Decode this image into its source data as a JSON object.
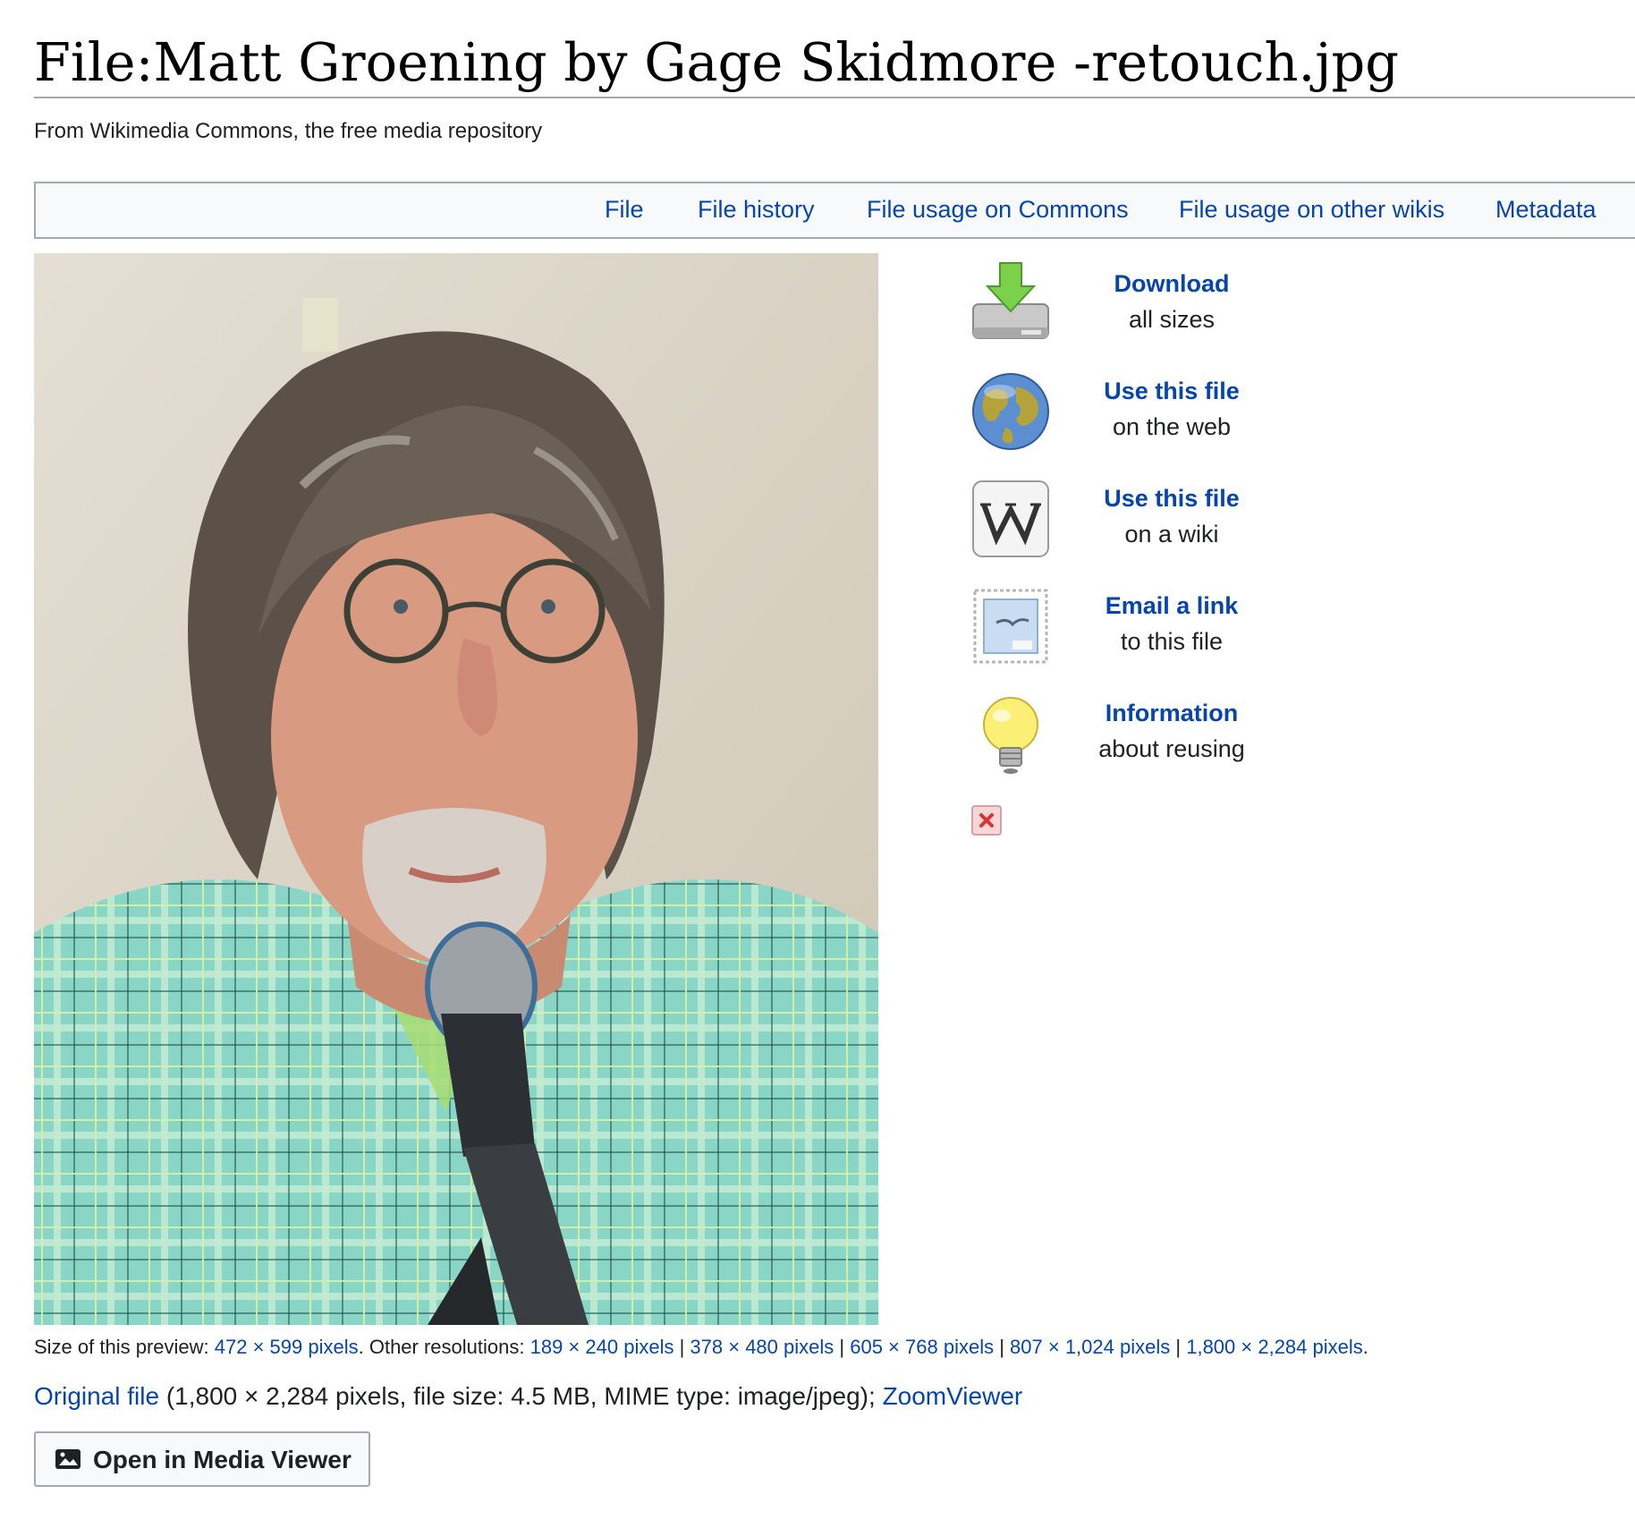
{
  "page": {
    "title": "File:Matt Groening by Gage Skidmore -retouch.jpg",
    "subtitle": "From Wikimedia Commons, the free media repository"
  },
  "tabs": [
    {
      "label": "File"
    },
    {
      "label": "File history"
    },
    {
      "label": "File usage on Commons"
    },
    {
      "label": "File usage on other wikis"
    },
    {
      "label": "Metadata"
    }
  ],
  "actions": [
    {
      "title": "Download",
      "sub": "all sizes",
      "icon": "download-icon"
    },
    {
      "title": "Use this file",
      "sub": "on the web",
      "icon": "globe-icon"
    },
    {
      "title": "Use this file",
      "sub": "on a wiki",
      "icon": "wikipedia-icon"
    },
    {
      "title": "Email a link",
      "sub": "to this file",
      "icon": "stamp-icon"
    },
    {
      "title": "Information",
      "sub": "about reusing",
      "icon": "lightbulb-icon"
    }
  ],
  "close_icon": "close-icon",
  "preview": {
    "label": "Size of this preview:",
    "size": "472 × 599 pixels",
    "other_label": "Other resolutions:",
    "resolutions": [
      "189 × 240 pixels",
      "378 × 480 pixels",
      "605 × 768 pixels",
      "807 × 1,024 pixels",
      "1,800 × 2,284 pixels"
    ],
    "separator": "|"
  },
  "original": {
    "link": "Original file",
    "details": "(1,800 × 2,284 pixels, file size: 4.5 MB, MIME type: image/jpeg);",
    "zoom": "ZoomViewer"
  },
  "media_viewer": {
    "label": "Open in Media Viewer",
    "icon": "image-icon"
  },
  "colors": {
    "link": "#0645ad",
    "border": "#a2a9b1",
    "tab_bg": "#f8f9fa",
    "shirt": "#8ad6c6"
  }
}
